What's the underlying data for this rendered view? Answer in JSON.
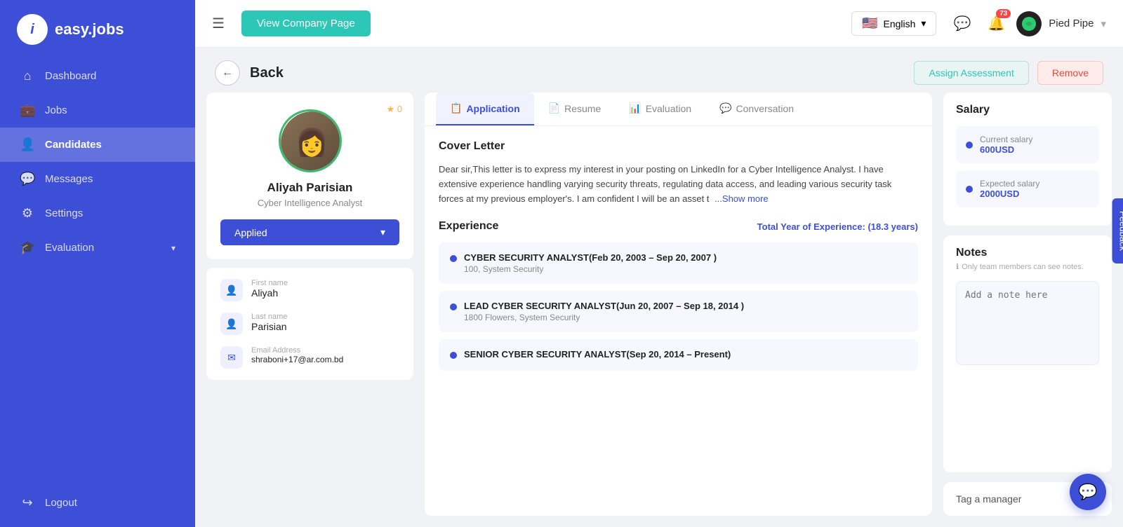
{
  "sidebar": {
    "logo_text": "easy.jobs",
    "logo_icon": "i",
    "items": [
      {
        "label": "Dashboard",
        "icon": "⌂",
        "active": false
      },
      {
        "label": "Jobs",
        "icon": "💼",
        "active": false
      },
      {
        "label": "Candidates",
        "icon": "👤",
        "active": true
      },
      {
        "label": "Messages",
        "icon": "💬",
        "active": false
      },
      {
        "label": "Settings",
        "icon": "⚙",
        "active": false
      },
      {
        "label": "Evaluation",
        "icon": "🎓",
        "active": false,
        "has_arrow": true
      }
    ],
    "logout_label": "Logout"
  },
  "topbar": {
    "menu_icon": "☰",
    "view_company_label": "View Company Page",
    "language": "English",
    "notification_count": "73",
    "company_name": "Pied Pipe"
  },
  "back_bar": {
    "back_label": "Back",
    "assign_label": "Assign Assessment",
    "remove_label": "Remove"
  },
  "candidate": {
    "name": "Aliyah Parisian",
    "title": "Cyber Intelligence Analyst",
    "star": "★ 0",
    "status": "Applied",
    "first_name_label": "First name",
    "first_name": "Aliyah",
    "last_name_label": "Last name",
    "last_name": "Parisian",
    "email_label": "Email Address",
    "email": "shraboni+17@ar.com.bd"
  },
  "tabs": [
    {
      "label": "Application",
      "icon": "📋",
      "active": true
    },
    {
      "label": "Resume",
      "icon": "📄",
      "active": false
    },
    {
      "label": "Evaluation",
      "icon": "📊",
      "active": false
    },
    {
      "label": "Conversation",
      "icon": "💬",
      "active": false
    }
  ],
  "cover_letter": {
    "title": "Cover Letter",
    "text": "Dear sir,This letter is to express my interest in your posting on LinkedIn for a  Cyber Intelligence Analyst. I have extensive experience handling varying security threats, regulating data access, and leading various security task forces at my previous employer's. I am confident I will be an asset t",
    "show_more": "...Show more"
  },
  "experience": {
    "title": "Experience",
    "total_label": "Total Year of Experience:",
    "total_years": "(18.3 years)",
    "items": [
      {
        "title": "CYBER SECURITY ANALYST(Feb 20, 2003 – Sep 20, 2007 )",
        "company": "100, System Security"
      },
      {
        "title": "LEAD CYBER SECURITY ANALYST(Jun 20, 2007 – Sep 18, 2014 )",
        "company": "1800 Flowers, System Security"
      },
      {
        "title": "SENIOR CYBER SECURITY ANALYST(Sep 20, 2014 – Present)",
        "company": ""
      }
    ]
  },
  "salary": {
    "title": "Salary",
    "current_label": "Current salary",
    "current_value": "600USD",
    "expected_label": "Expected salary",
    "expected_value": "2000USD"
  },
  "notes": {
    "title": "Notes",
    "subtitle": "Only team members can see notes.",
    "placeholder": "Add a note here"
  },
  "tag_manager": {
    "label": "Tag a manager"
  },
  "feedback": {
    "label": "Feedback"
  }
}
